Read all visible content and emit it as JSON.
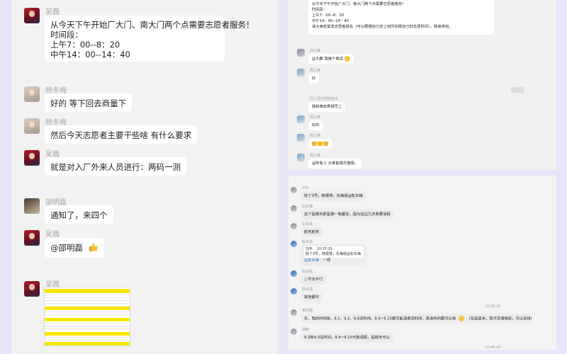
{
  "left": {
    "messages": [
      {
        "sender": "吴茜",
        "lines": [
          "从今天下午开始厂大门、南大门两个点需要志愿者服务！",
          "时间段：",
          "上午7：00--8：20",
          "中午14：00--14：40"
        ]
      },
      {
        "sender": "杨冬梅",
        "text": "好的 等下回去商量下"
      },
      {
        "sender": "杨冬梅",
        "text": "然后今天志愿者主要干些啥  有什么要求"
      },
      {
        "sender": "吴茜",
        "text": "就是对入厂外来人员进行：两码一测"
      },
      {
        "sender": "邵明磊",
        "text": "通知了，来四个"
      },
      {
        "sender": "吴茜",
        "text": "@邵明磊"
      },
      {
        "sender": "吴茜"
      }
    ]
  },
  "top_right": {
    "announcement": [
      "从今天下午开始厂大门、南大门两个点需要志愿者服务！",
      "时间段：",
      "上午7：00--8：20",
      "中午14：00--14：40",
      "请大家赶紧发志愿者报名（可以根据自己的上班时间报自己的志愿时间），我来排班。"
    ],
    "messages": [
      {
        "sender": "刘小梅",
        "text": "@大鹏 我报个两点"
      },
      {
        "sender": "周三英",
        "text": "好"
      },
      {
        "sender": "同人员万的搞技术",
        "text": "我和黄启秀报早上"
      },
      {
        "sender": "周三英",
        "text": "好的"
      },
      {
        "sender": "周三英",
        "text": ""
      },
      {
        "sender": "周三英",
        "text": "@所有人 大家能报尽量报。"
      }
    ]
  },
  "bottom_right": {
    "messages": [
      {
        "sender": "刘平",
        "text": "除了3号，随便排，东梅组@彭东梅"
      },
      {
        "sender": "彭东梅",
        "text": "这个星期天那星期一我都去，因为后边几天我要请假"
      },
      {
        "sender": "彭东梅",
        "text": "欧克欧克"
      },
      {
        "sender": "陈永强",
        "quote_name": "刘平",
        "quote_time": "10:37:15",
        "quote_text": "除了3号，随便排，东梅组@彭东梅",
        "text": "一样",
        "mention": "@彭东梅"
      },
      {
        "sender": "陈永强",
        "text": "二号也不行"
      },
      {
        "sender": "陈永强",
        "text": "其他都可"
      },
      {
        "sender": "黄芝梅",
        "text": "东、我的时间是，9.1、9.2、9.6没时间，9.9~9.15都可能请假没时间，其他时间都可以排",
        "extra": "（包括周末，我不存储候班，可以安排）"
      },
      {
        "sender": "胡晓",
        "text": "9.2和9.3没时间，9.9~9.15可能请假，星期天可以"
      }
    ],
    "times": [
      "10:42:32",
      "10:46:43"
    ]
  }
}
